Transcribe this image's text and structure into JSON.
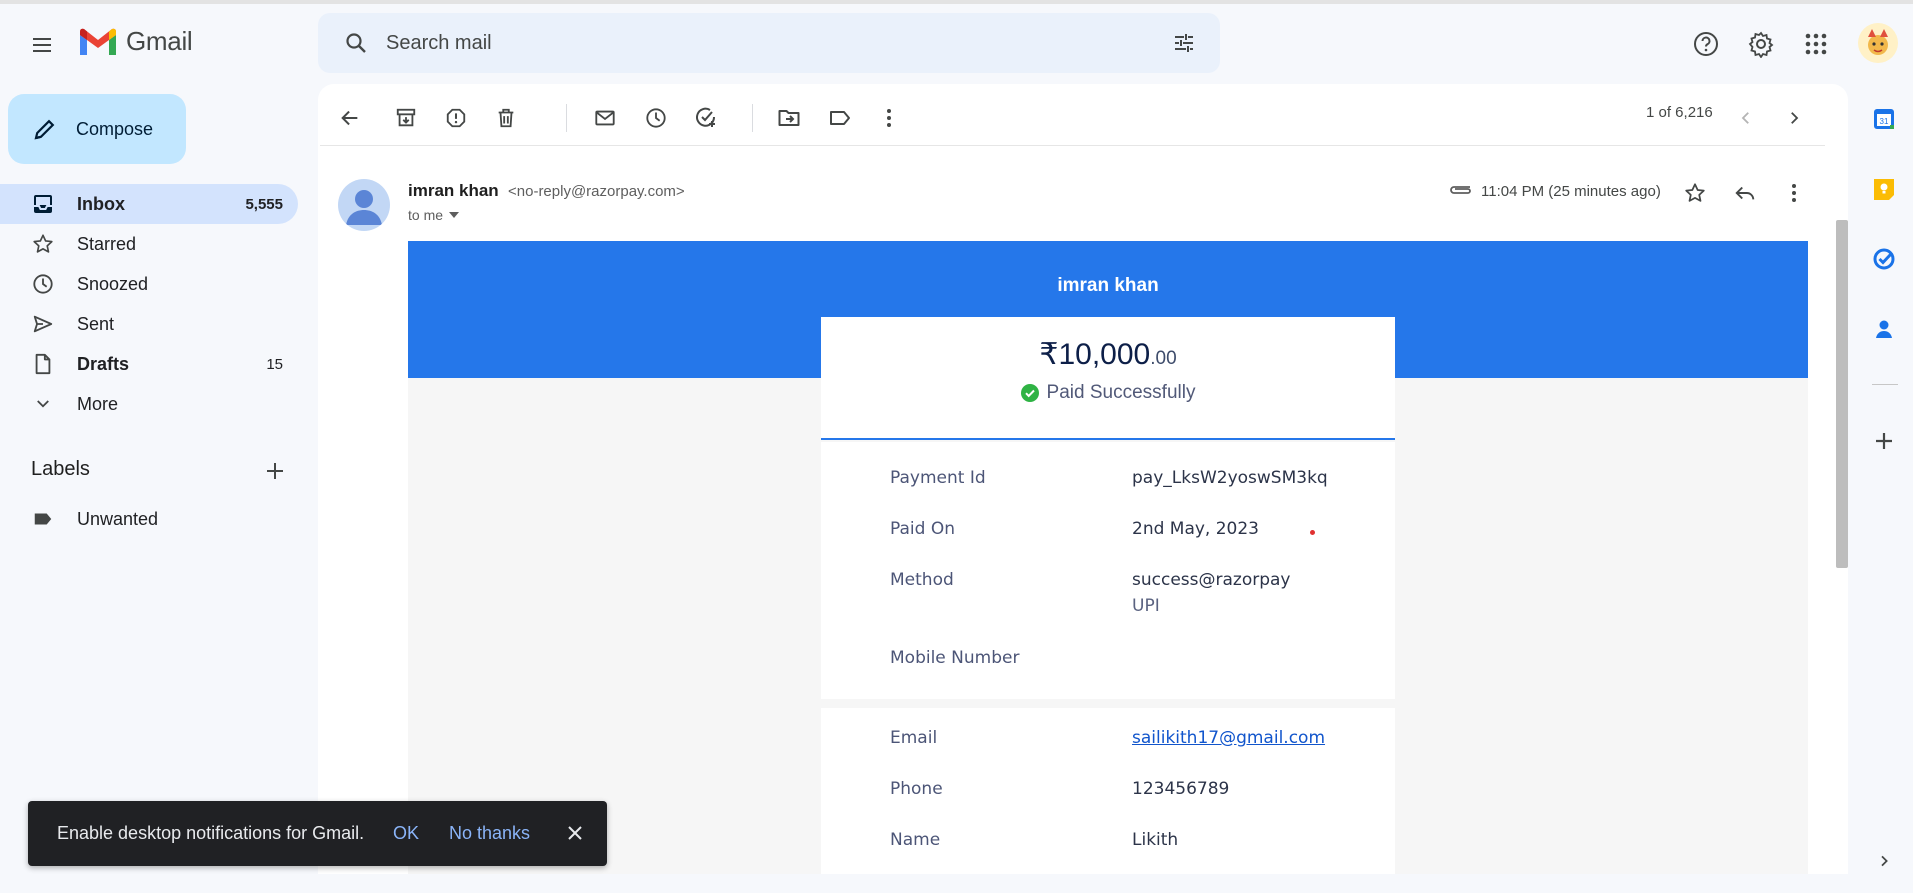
{
  "app": {
    "name": "Gmail"
  },
  "search": {
    "placeholder": "Search mail"
  },
  "compose": {
    "label": "Compose"
  },
  "nav": {
    "items": [
      {
        "label": "Inbox",
        "count": "5,555",
        "icon": "inbox-icon"
      },
      {
        "label": "Starred",
        "count": "",
        "icon": "star-icon"
      },
      {
        "label": "Snoozed",
        "count": "",
        "icon": "clock-icon"
      },
      {
        "label": "Sent",
        "count": "",
        "icon": "send-icon"
      },
      {
        "label": "Drafts",
        "count": "15",
        "icon": "draft-icon"
      },
      {
        "label": "More",
        "count": "",
        "icon": "chevron-down-icon"
      }
    ]
  },
  "labels": {
    "title": "Labels",
    "items": [
      {
        "label": "Unwanted"
      }
    ]
  },
  "toolbar": {
    "paging": "1 of 6,216"
  },
  "email": {
    "sender_name": "imran khan",
    "sender_email": "<no-reply@razorpay.com>",
    "to": "to me",
    "time": "11:04 PM (25 minutes ago)"
  },
  "receipt": {
    "merchant": "imran khan",
    "amount_main": "₹10,000",
    "amount_decimal": ".00",
    "status": "Paid Successfully",
    "rows": [
      {
        "label": "Payment Id",
        "value": "pay_LksW2yoswSM3kq"
      },
      {
        "label": "Paid On",
        "value": "2nd May, 2023"
      },
      {
        "label": "Method",
        "value": "success@razorpay",
        "sub": "UPI"
      },
      {
        "label": "Mobile Number",
        "value": ""
      }
    ],
    "contact_rows": [
      {
        "label": "Email",
        "value": "sailikith17@gmail.com"
      },
      {
        "label": "Phone",
        "value": "123456789"
      },
      {
        "label": "Name",
        "value": "Likith"
      }
    ]
  },
  "snackbar": {
    "text": "Enable desktop notifications for Gmail.",
    "ok": "OK",
    "no_thanks": "No thanks"
  },
  "colors": {
    "banner": "#2577ea",
    "compose_bg": "#c2e7ff",
    "nav_active": "#d3e3fd",
    "search_bg": "#eaf1fb",
    "success": "#2fb344"
  }
}
